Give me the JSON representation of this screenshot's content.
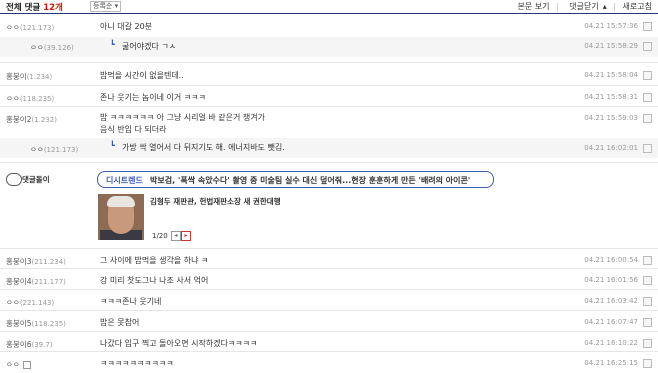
{
  "header": {
    "title_prefix": "전체 댓글",
    "count": "12개",
    "sort": "등록순",
    "view_body": "본문 보기",
    "close_comments": "댓글닫기",
    "refresh": "새로고침"
  },
  "comments": [
    {
      "nick": "ㅇㅇ",
      "ip": "(121.173)",
      "text": "아니 대갈 20분",
      "date": "04.21 15:57:36",
      "reply": false
    },
    {
      "nick": "ㅇㅇ",
      "ip": "(39.126)",
      "text": "굶어야겠다 ㄱㅅ",
      "date": "04.21 15:58:29",
      "reply": true
    },
    {
      "nick": "홍붕이",
      "ip": "(1.234)",
      "text": "밥먹을 시간이 없을텐데..",
      "date": "04.21 15:58:04",
      "reply": false
    },
    {
      "nick": "ㅇㅇ",
      "ip": "(118.235)",
      "text": "존나 웃기는 놈이네 이거 ㅋㅋㅋ",
      "date": "04.21 15:58:31",
      "reply": false
    },
    {
      "nick": "홍붕이2",
      "ip": "(1.232)",
      "text": "밥 ㅋㅋㅋㅋㅋㅋ 아 그냥 시리얼 바 같은거 챙겨가",
      "text2": "음식 반입 다 되더라",
      "date": "04.21 15:59:03",
      "reply": false
    },
    {
      "nick": "ㅇㅇ",
      "ip": "(121.173)",
      "text": "가방 싹 열어서 다 뒤지기도 해. 에너지바도 뺏김.",
      "date": "04.21 16:02:01",
      "reply": true
    }
  ],
  "ad": {
    "label": "댓글돌이",
    "brand": "디시트렌드",
    "headline": "박보검, '폭싹 속았수다' 촬영 중 미술팀 실수 대신 덮어줘...현장 훈훈하게 만든 '배려의 아이콘'",
    "subheadline": "김형두 재판관, 헌법재판소장 새 권한대행",
    "pager": "1/20"
  },
  "comments2": [
    {
      "nick": "홍붕이3",
      "ip": "(211.234)",
      "text": "그 사이에 밥먹을 생각을 하냐 ㅋ",
      "date": "04.21 16:00:54"
    },
    {
      "nick": "홍붕이4",
      "ip": "(211.177)",
      "text": "강 미리 찻도그나 나조 사서 억어",
      "date": "04.21 16:01:56"
    },
    {
      "nick": "ㅇㅇ",
      "ip": "(221.143)",
      "text": "ㅋㅋㅋ존나 웃기네",
      "date": "04.21 16:03:42"
    },
    {
      "nick": "홍붕이5",
      "ip": "(118.235)",
      "text": "밥은 못참어",
      "date": "04.21 16:07:47"
    },
    {
      "nick": "홍붕이6",
      "ip": "(39.7)",
      "text": "나갔다 입구 찍고 돌아오면 시작하겠다ㅋㅋㅋㅋ",
      "date": "04.21 16:10:22"
    },
    {
      "nick": "ㅇㅇ",
      "ip": "",
      "text": "ㅋㅋㅋㅋㅋㅋㅋㅋㅋㅋ",
      "date": "04.21 16:25:15"
    }
  ]
}
